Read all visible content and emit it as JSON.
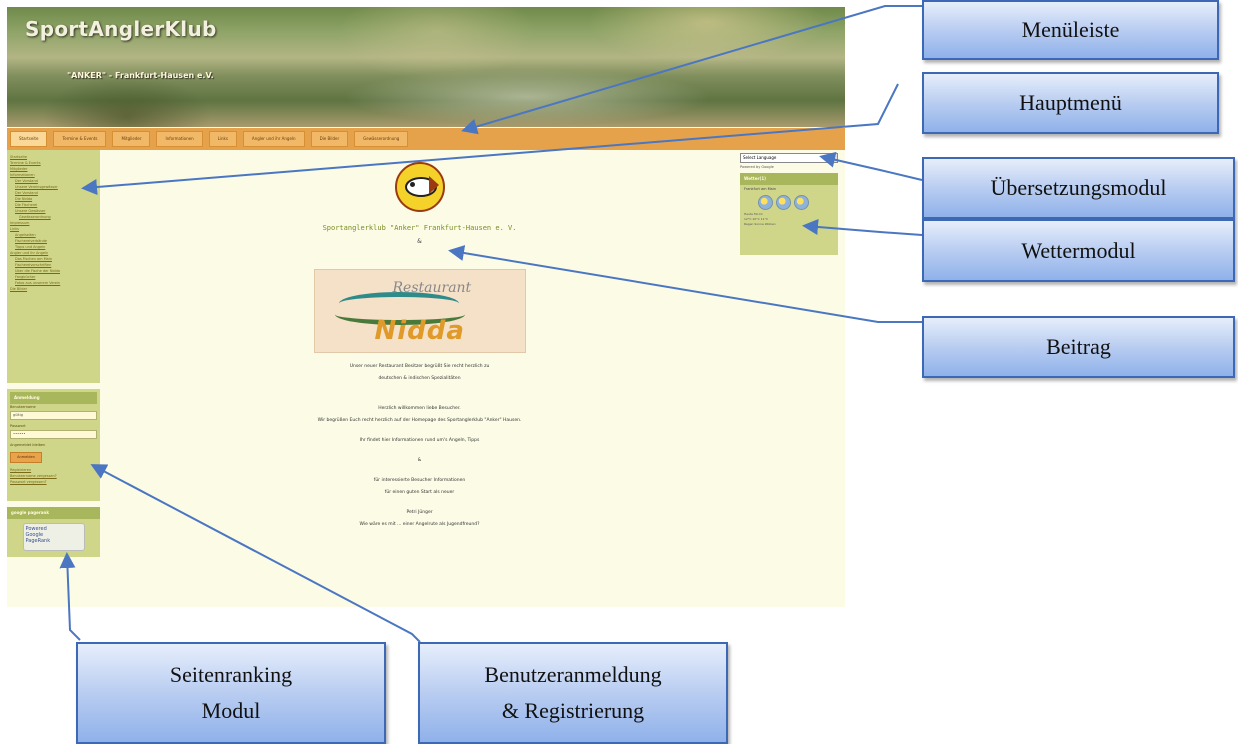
{
  "site": {
    "title": "SportAnglerKlub",
    "subtitle": "\"ANKER\" - Frankfurt-Hausen e.V.",
    "top_nav": [
      "Startseite",
      "Termine & Events",
      "Mitglieder",
      "Informationen",
      "Links",
      "Angler und ihr Angeln",
      "Die Bilder",
      "Gewässerordnung"
    ],
    "left_menu": [
      {
        "label": "Startseite",
        "level": 0
      },
      {
        "label": "Termine & Events",
        "level": 0
      },
      {
        "label": "Mitglieder",
        "level": 0
      },
      {
        "label": "Informationen",
        "level": 0
      },
      {
        "label": "Der Vorstand",
        "level": 1
      },
      {
        "label": "Unsere Vereinsgewässer",
        "level": 1
      },
      {
        "label": "Der Vorstand",
        "level": 1
      },
      {
        "label": "Die Nidda",
        "level": 1
      },
      {
        "label": "Die Fischerei",
        "level": 1
      },
      {
        "label": "Unsere Gewässer",
        "level": 1
      },
      {
        "label": "Gewässerordnung",
        "level": 2
      },
      {
        "label": "Impressum",
        "level": 0
      },
      {
        "label": "Links",
        "level": 0
      },
      {
        "label": "Angelseiten",
        "level": 1
      },
      {
        "label": "Fischereiverbände",
        "level": 1
      },
      {
        "label": "Tipps und Angeln",
        "level": 1
      },
      {
        "label": "Angler und ihr Angeln",
        "level": 0
      },
      {
        "label": "Das Fischen am Main",
        "level": 1
      },
      {
        "label": "Fischereivorschriften",
        "level": 1
      },
      {
        "label": "Über die Fische der Nidda",
        "level": 1
      },
      {
        "label": "Fangbücher",
        "level": 1
      },
      {
        "label": "Fotos aus unserem Verein",
        "level": 1
      },
      {
        "label": "Die Bilder",
        "level": 0
      }
    ],
    "login": {
      "title": "Anmeldung",
      "username_label": "Benutzername",
      "username_value": "gültig",
      "password_label": "Passwort",
      "password_value": "••••••",
      "remember_label": "Angemeldet bleiben",
      "button": "Anmelden",
      "links": [
        "Registrieren",
        "Benutzername vergessen?",
        "Passwort vergessen?"
      ]
    },
    "ranking": {
      "title": "google pagerank",
      "badge_line1": "Powered",
      "badge_line2": "Google",
      "badge_line3": "PageRank"
    },
    "content": {
      "club_name": "Sportanglerklub \"Anker\" Frankfurt-Hausen e. V.",
      "amp": "&",
      "restaurant_script": "Restaurant",
      "restaurant_name": "Nidda",
      "p1": "Unser neuer Restaurant Besitzer begrüßt Sie recht herzlich zu",
      "p2": "deutschen & indischen Spezialitäten",
      "p3": "Herzlich willkommen liebe Besucher.",
      "p4": "Wir begrüßen Euch recht herzlich auf der Homepage des Sportanglerklub \"Anker\" Hausen.",
      "p5": "Ihr findet hier Informationen rund um's Angeln, Tipps",
      "p6": "&",
      "p7": "für interessierte Besucher Informationen",
      "p8": "für einen guten Start als neuer",
      "p9": "Petri Jünger",
      "p10": "Wie wäre es mit ... einer Angelrute als Jugendfreund?"
    },
    "right": {
      "language_select": "Select Language",
      "powered": "Powered by Google",
      "weather_title": "Wetter(1)",
      "weather_location": "Frankfurt am Main",
      "weather_rows": [
        "Heute   Mo   Di",
        "12°C    10°C   11°C",
        "Regen  Sonne  Wolken"
      ]
    }
  },
  "annotations": {
    "menuleiste": "Menüleiste",
    "hauptmenu": "Hauptmenü",
    "uebersetzung": "Übersetzungsmodul",
    "wetter": "Wettermodul",
    "beitrag": "Beitrag",
    "ranking_line1": "Seitenranking",
    "ranking_line2": "Modul",
    "login_line1": "Benutzeranmeldung",
    "login_line2": "& Registrierung"
  },
  "colors": {
    "callout_border": "#3d68b5",
    "arrow": "#4a76c2",
    "nav": "#e6a24b",
    "sidebar": "#cfd68a"
  }
}
